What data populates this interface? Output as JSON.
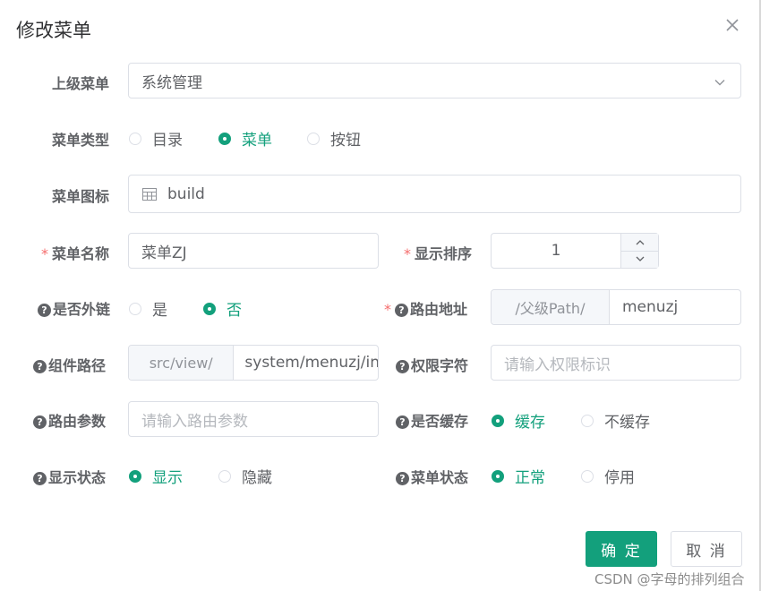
{
  "dialog": {
    "title": "修改菜单"
  },
  "form": {
    "parent": {
      "label": "上级菜单",
      "value": "系统管理"
    },
    "menu_type": {
      "label": "菜单类型",
      "options": [
        "目录",
        "菜单",
        "按钮"
      ],
      "selected": "菜单"
    },
    "icon": {
      "label": "菜单图标",
      "value": "build",
      "icon_name": "table-icon"
    },
    "menu_name": {
      "label": "菜单名称",
      "value": "菜单ZJ",
      "required": true
    },
    "sort": {
      "label": "显示排序",
      "value": "1",
      "required": true
    },
    "is_frame": {
      "label": "是否外链",
      "options": [
        "是",
        "否"
      ],
      "selected": "否"
    },
    "route_path": {
      "label": "路由地址",
      "prepend": "/父级Path/",
      "value": "menuzj",
      "required": true
    },
    "component": {
      "label": "组件路径",
      "prepend": "src/view/",
      "value": "system/menuzj/in"
    },
    "perms": {
      "label": "权限字符",
      "placeholder": "请输入权限标识"
    },
    "query": {
      "label": "路由参数",
      "placeholder": "请输入路由参数"
    },
    "cache": {
      "label": "是否缓存",
      "options": [
        "缓存",
        "不缓存"
      ],
      "selected": "缓存"
    },
    "visible": {
      "label": "显示状态",
      "options": [
        "显示",
        "隐藏"
      ],
      "selected": "显示"
    },
    "status": {
      "label": "菜单状态",
      "options": [
        "正常",
        "停用"
      ],
      "selected": "正常"
    }
  },
  "footer": {
    "confirm": "确 定",
    "cancel": "取 消"
  },
  "watermark": "CSDN @字母的排列组合",
  "colors": {
    "primary": "#13a07c",
    "required": "#f56c6c",
    "border": "#dcdfe6"
  }
}
